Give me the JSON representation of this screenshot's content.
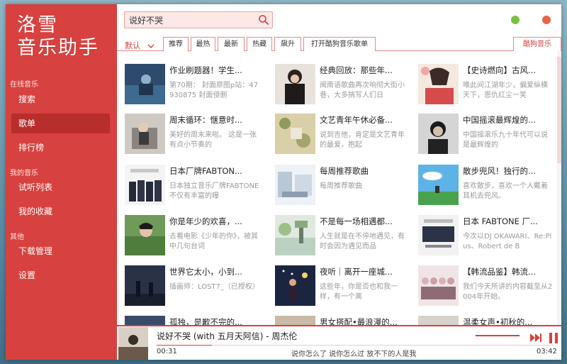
{
  "app": {
    "logo_line1": "洛雪",
    "logo_line2": "音乐助手"
  },
  "sidebar": {
    "groups": [
      {
        "title": "在线音乐",
        "items": [
          {
            "label": "搜索"
          },
          {
            "label": "歌单"
          },
          {
            "label": "排行榜"
          }
        ]
      },
      {
        "title": "我的音乐",
        "items": [
          {
            "label": "试听列表"
          },
          {
            "label": "我的收藏"
          }
        ]
      },
      {
        "title": "其他",
        "items": [
          {
            "label": "下载管理"
          },
          {
            "label": "设置"
          }
        ]
      }
    ],
    "active_item": "歌单"
  },
  "search": {
    "value": "说好不哭",
    "icon": "search-icon"
  },
  "window_controls": {
    "minimize_color": "#7bc043",
    "close_color": "#e8644a"
  },
  "sort": {
    "label": "默认"
  },
  "tabs": [
    {
      "label": "推荐"
    },
    {
      "label": "最热"
    },
    {
      "label": "最新"
    },
    {
      "label": "热藏"
    },
    {
      "label": "飙升"
    },
    {
      "label": "打开酷狗音乐歌单"
    }
  ],
  "active_tab": "推荐",
  "source_tab": {
    "label": "酷狗音乐"
  },
  "playlists": [
    {
      "title": "作业刷题器！学生...",
      "desc": "第70期： 封面原图p站：47930875 封面侵删"
    },
    {
      "title": "经典回放：那些年...",
      "desc": "闽南语歌曲再次响彻大街小巷，大多揣写人们日"
    },
    {
      "title": "【史诗燃向】古风...",
      "desc": "唯此间江湖年少，偏爱纵横天下，恩仇红尘一笑"
    },
    {
      "title": "周末循环：惬意时...",
      "desc": "美好的周末来啦。 这是一张有点小节奏的"
    },
    {
      "title": "文艺青年午休必备...",
      "desc": "说到吉他，肯定是文艺青年的最爱，抱起"
    },
    {
      "title": "中国摇滚最辉煌的...",
      "desc": "中国摇滚乐九十年代可以说是最辉煌的"
    },
    {
      "title": "日本厂牌FABTON...",
      "desc": "日本独立音乐厂牌FABTONE不仅有丰富的曝"
    },
    {
      "title": "每周推荐歌曲",
      "desc": "每周推荐歌曲"
    },
    {
      "title": "散步兜风！独行的...",
      "desc": "喜欢散步，喜欢一个人戴着耳机去兜风。"
    },
    {
      "title": "你是年少的欢喜，...",
      "desc": "去看电影《少年的你》，被其中几句台词"
    },
    {
      "title": "不是每一场相遇都...",
      "desc": "人生就是在不停地遇见，有时会因为遇见而品"
    },
    {
      "title": "日本 FABTONE 厂...",
      "desc": "今次以DJ OKAWARI、Re:Plus、Robert de B"
    },
    {
      "title": "世界它太小，小到...",
      "desc": "插画师：LOST7_（已授权）"
    },
    {
      "title": "夜听｜离开一座城...",
      "desc": "这些年，你是否也和我一样，有一个离"
    },
    {
      "title": "【韩流品鉴】韩流...",
      "desc": "我们今天所讲的内容截至从2004年开始。"
    },
    {
      "title": "孤独，是歉不完的...",
      "desc": ""
    },
    {
      "title": "男女搭配•最浪漫的...",
      "desc": ""
    },
    {
      "title": "温柔女声•初秋的...",
      "desc": ""
    }
  ],
  "player": {
    "title": "说好不哭 (with 五月天阿信) - 周杰伦",
    "current_time": "00:31",
    "total_time": "03:42",
    "lyric": "说你怎么了 说你怎么过 放不下的人是我",
    "progress": 0.14,
    "volume": 1.0
  }
}
